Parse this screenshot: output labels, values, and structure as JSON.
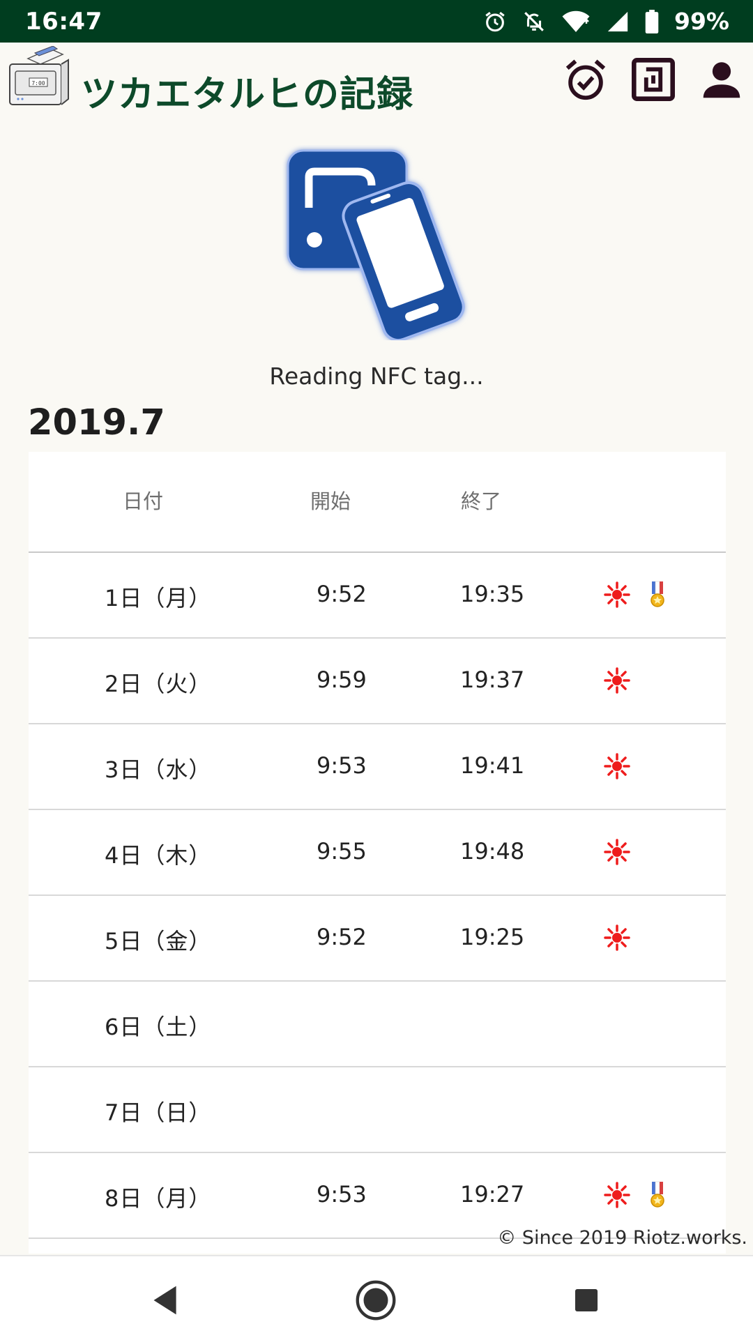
{
  "status_bar": {
    "time": "16:47",
    "battery": "99%",
    "icons": [
      "alarm-icon",
      "notifications-off-icon",
      "wifi-icon",
      "signal-icon",
      "battery-icon"
    ]
  },
  "app": {
    "title": "ツカエタルヒの記録",
    "actions": [
      "alarm-check-icon",
      "nfc-icon",
      "account-icon"
    ]
  },
  "nfc": {
    "status": "Reading NFC tag..."
  },
  "month": "2019.7",
  "table": {
    "headers": {
      "date": "日付",
      "start": "開始",
      "end": "終了"
    },
    "rows": [
      {
        "date": "1日（月）",
        "start": "9:52",
        "end": "19:35",
        "icons": [
          "sun-icon",
          "medal-icon"
        ]
      },
      {
        "date": "2日（火）",
        "start": "9:59",
        "end": "19:37",
        "icons": [
          "sun-icon"
        ]
      },
      {
        "date": "3日（水）",
        "start": "9:53",
        "end": "19:41",
        "icons": [
          "sun-icon"
        ]
      },
      {
        "date": "4日（木）",
        "start": "9:55",
        "end": "19:48",
        "icons": [
          "sun-icon"
        ]
      },
      {
        "date": "5日（金）",
        "start": "9:52",
        "end": "19:25",
        "icons": [
          "sun-icon"
        ]
      },
      {
        "date": "6日（土）",
        "start": "",
        "end": "",
        "icons": []
      },
      {
        "date": "7日（日）",
        "start": "",
        "end": "",
        "icons": []
      },
      {
        "date": "8日（月）",
        "start": "9:53",
        "end": "19:27",
        "icons": [
          "sun-icon",
          "medal-icon"
        ]
      }
    ]
  },
  "footer": {
    "copyright": "© Since 2019 Riotz.works."
  },
  "colors": {
    "status_bar_bg": "#003d1f",
    "title_green": "#0d4a2a",
    "nfc_blue": "#1f4fa0",
    "sun_red": "#ee1c1c",
    "action_dark": "#2b0f1e"
  }
}
